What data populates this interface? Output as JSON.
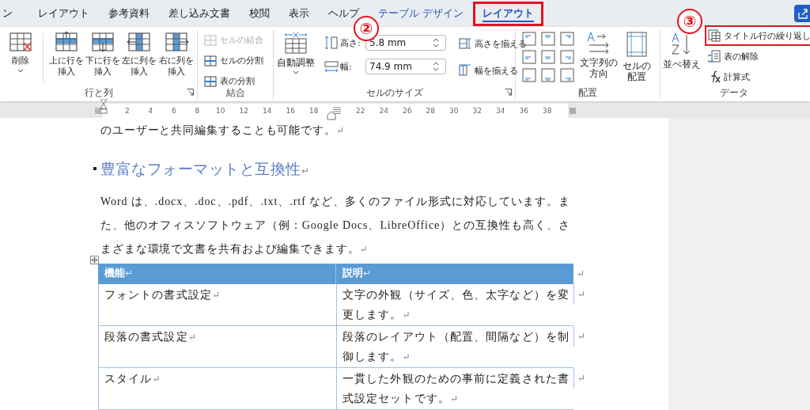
{
  "tabs": [
    {
      "label": "ン",
      "kind": "plain",
      "selected": false,
      "highlighted": false
    },
    {
      "label": "レイアウト",
      "kind": "plain",
      "selected": false,
      "highlighted": false
    },
    {
      "label": "参考資料",
      "kind": "plain",
      "selected": false,
      "highlighted": false
    },
    {
      "label": "差し込み文書",
      "kind": "plain",
      "selected": false,
      "highlighted": false
    },
    {
      "label": "校閲",
      "kind": "plain",
      "selected": false,
      "highlighted": false
    },
    {
      "label": "表示",
      "kind": "plain",
      "selected": false,
      "highlighted": false
    },
    {
      "label": "ヘルプ",
      "kind": "plain",
      "selected": false,
      "highlighted": false
    },
    {
      "label": "テーブル デザイン",
      "kind": "context",
      "selected": false,
      "highlighted": false
    },
    {
      "label": "レイアウト",
      "kind": "context",
      "selected": true,
      "highlighted": true
    }
  ],
  "annotations": [
    {
      "label": "②"
    },
    {
      "label": "③"
    }
  ],
  "ribbon": {
    "rows_columns": {
      "label": "行と列",
      "buttons": [
        {
          "lines": [
            "削除"
          ],
          "dropdown": true
        },
        {
          "lines": [
            "上に行を",
            "挿入"
          ],
          "dropdown": false
        },
        {
          "lines": [
            "下に行を",
            "挿入"
          ],
          "dropdown": false
        },
        {
          "lines": [
            "左に列を",
            "挿入"
          ],
          "dropdown": false
        },
        {
          "lines": [
            "右に列を",
            "挿入"
          ],
          "dropdown": false
        }
      ]
    },
    "merge": {
      "label": "結合",
      "buttons": [
        {
          "label": "セルの結合",
          "disabled": true
        },
        {
          "label": "セルの分割",
          "disabled": false
        },
        {
          "label": "表の分割",
          "disabled": false
        }
      ]
    },
    "cell_size": {
      "label": "セルのサイズ",
      "autofit": {
        "lines": [
          "自動調整"
        ],
        "dropdown": true
      },
      "height": {
        "label": "高さ:",
        "value": "5.8 mm"
      },
      "width": {
        "label": "幅:",
        "value": "74.9 mm"
      },
      "distribute": [
        {
          "label": "高さを揃える"
        },
        {
          "label": "幅を揃える"
        }
      ]
    },
    "alignment": {
      "label": "配置",
      "buttons": [
        {
          "lines": [
            "文字列の",
            "方向"
          ]
        },
        {
          "lines": [
            "セルの",
            "配置"
          ]
        }
      ]
    },
    "data": {
      "label": "データ",
      "sort": {
        "lines": [
          "並べ替え"
        ]
      },
      "buttons": [
        {
          "label": "タイトル行の繰り返し",
          "highlighted": true
        },
        {
          "label": "表の解除",
          "highlighted": false
        },
        {
          "label": "計算式",
          "highlighted": false
        }
      ]
    }
  },
  "ruler": [
    "2",
    "4",
    "6",
    "8",
    "10",
    "12",
    "14",
    "16",
    "18",
    "22",
    "24",
    "26",
    "28",
    "30",
    "32",
    "34",
    "36",
    "38"
  ],
  "document": {
    "blocks": [
      {
        "kind": "body",
        "text": "のユーザーと共同編集することも可能です。",
        "mark": "↵"
      },
      {
        "kind": "heading",
        "text": "豊富なフォーマットと互換性",
        "mark": "↵"
      },
      {
        "kind": "body",
        "text": "Word は、.docx、.doc、.pdf、.txt、.rtf など、多くのファイル形式に対応しています。また、他のオフィスソフトウェア（例：Google Docs、LibreOffice）との互換性も高く、さまざまな環境で文書を共有および編集できます。",
        "mark": "↵"
      }
    ],
    "table": {
      "columns": [
        {
          "label": "機能",
          "mark": "↵"
        },
        {
          "label": "説明",
          "mark": "↵"
        }
      ],
      "header_end": "↵",
      "rows": [
        {
          "cells": [
            {
              "text": "フォントの書式設定",
              "mark": "↵"
            },
            {
              "text": "文字の外観（サイズ、色、太字など）を変更します。",
              "mark": "↵"
            }
          ],
          "end": "↵"
        },
        {
          "cells": [
            {
              "text": "段落の書式設定",
              "mark": "↵"
            },
            {
              "text": "段落のレイアウト（配置、間隔など）を制御します。",
              "mark": "↵"
            }
          ],
          "end": "↵"
        },
        {
          "cells": [
            {
              "text": "スタイル",
              "mark": "↵"
            },
            {
              "text": "一貫した外観のための事前に定義された書式設定セットです。",
              "mark": "↵"
            }
          ],
          "end": "↵"
        }
      ]
    }
  }
}
